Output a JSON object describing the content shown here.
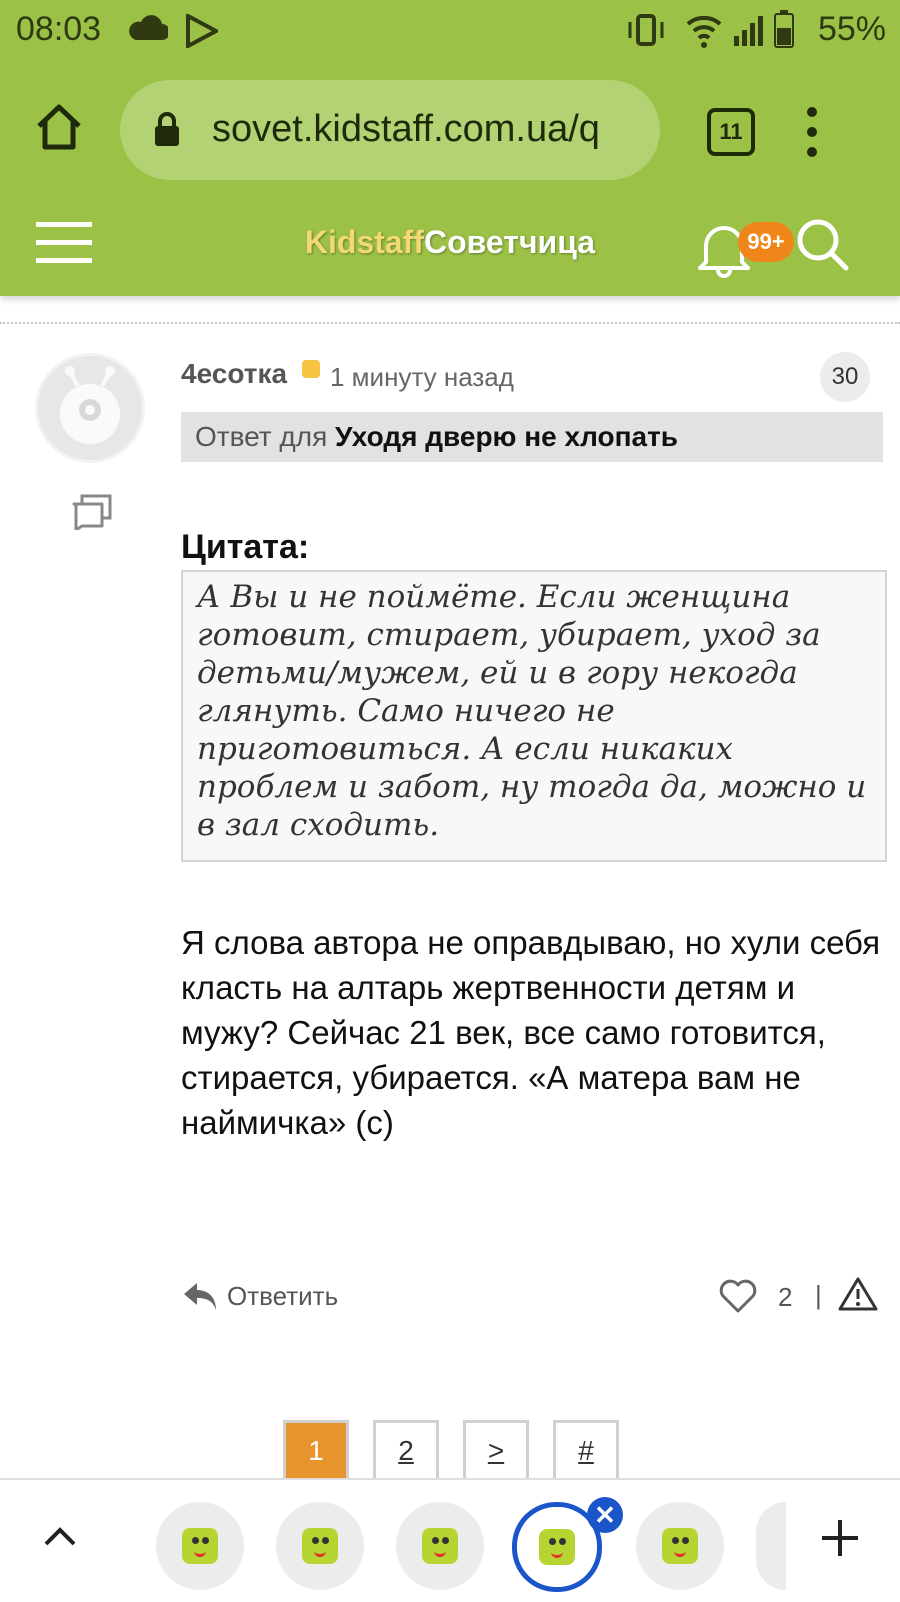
{
  "status_bar": {
    "time": "08:03",
    "battery": "55%"
  },
  "browser": {
    "url": "sovet.kidstaff.com.ua/q",
    "tab_count": "11"
  },
  "site_header": {
    "logo_part1": "Kidstaff",
    "logo_part2": "Советчица",
    "notifications_badge": "99+"
  },
  "post": {
    "author": "4есотка",
    "time": "1 минуту назад",
    "number": "30",
    "reply_to_prefix": "Ответ для ",
    "reply_to_target": "Уходя дверю не хлопать",
    "quote_title": "Цитата:",
    "quote_text": "А Вы и не поймёте. Если женщина готовит, стирает, убирает, уход за детьми/мужем, ей и в гору некогда глянуть. Само ничего не приготовиться. А если никаких проблем и забот, ну тогда да, можно и в зал сходить.",
    "body": "Я слова автора не оправдываю, но хули себя класть на алтарь жертвенности детям и мужу? Сейчас 21 век, все само готовится, стирается, убирается. «А матера вам не наймичка» (с)",
    "reply_label": "Ответить",
    "likes": "2",
    "separator": "|"
  },
  "pagination": {
    "pages": [
      "1",
      "2",
      ">",
      "#"
    ],
    "active": "1"
  },
  "bottom_bar": {
    "open_tabs_visible": 5,
    "active_tab_index": 3
  },
  "colors": {
    "brand_green": "#9bc146",
    "accent_orange": "#e8942c",
    "active_tab_blue": "#1a56c9"
  }
}
